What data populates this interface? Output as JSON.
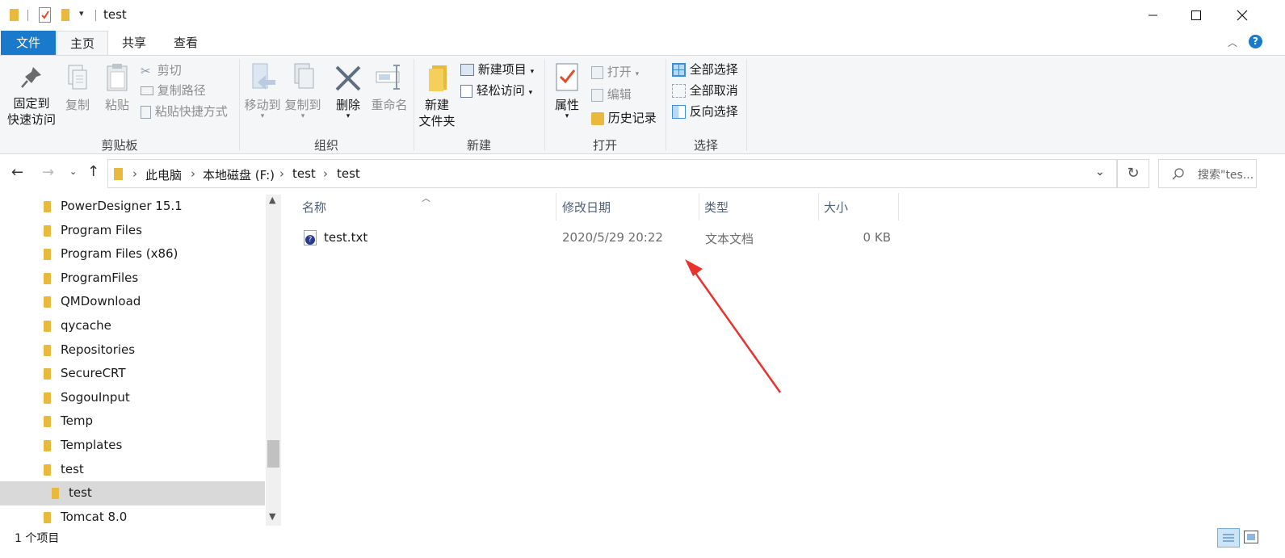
{
  "window": {
    "title": "test"
  },
  "ribbon_tabs": {
    "file": "文件",
    "home": "主页",
    "share": "共享",
    "view": "查看"
  },
  "clipboard": {
    "pin_line1": "固定到",
    "pin_line2": "快速访问",
    "copy": "复制",
    "paste": "粘贴",
    "cut": "剪切",
    "copy_path": "复制路径",
    "paste_shortcut": "粘贴快捷方式",
    "group": "剪贴板"
  },
  "organize": {
    "move_to": "移动到",
    "copy_to": "复制到",
    "delete": "删除",
    "rename": "重命名",
    "group": "组织"
  },
  "new": {
    "new_item": "新建项目",
    "easy_access": "轻松访问",
    "new_folder_line1": "新建",
    "new_folder_line2": "文件夹",
    "group": "新建"
  },
  "open": {
    "properties": "属性",
    "open": "打开",
    "edit": "编辑",
    "history": "历史记录",
    "group": "打开"
  },
  "select": {
    "select_all": "全部选择",
    "select_none": "全部取消",
    "invert": "反向选择",
    "group": "选择"
  },
  "address": {
    "crumbs": [
      "此电脑",
      "本地磁盘 (F:)",
      "test",
      "test"
    ],
    "search_placeholder": "搜索\"tes..."
  },
  "nav_items": [
    "PowerDesigner 15.1",
    "Program Files",
    "Program Files (x86)",
    "ProgramFiles",
    "QMDownload",
    "qycache",
    "Repositories",
    "SecureCRT",
    "SogouInput",
    "Temp",
    "Templates",
    "test",
    "test",
    "Tomcat  8.0"
  ],
  "columns": {
    "name": "名称",
    "modified": "修改日期",
    "type": "类型",
    "size": "大小"
  },
  "files": [
    {
      "name": "test.txt",
      "modified": "2020/5/29 20:22",
      "type": "文本文档",
      "size": "0 KB"
    }
  ],
  "status": {
    "count": "1 个项目"
  },
  "colors": {
    "file_tab": "#1979ca",
    "selected_row": "#d9d9d9",
    "annotation_arrow": "#e8332c"
  }
}
